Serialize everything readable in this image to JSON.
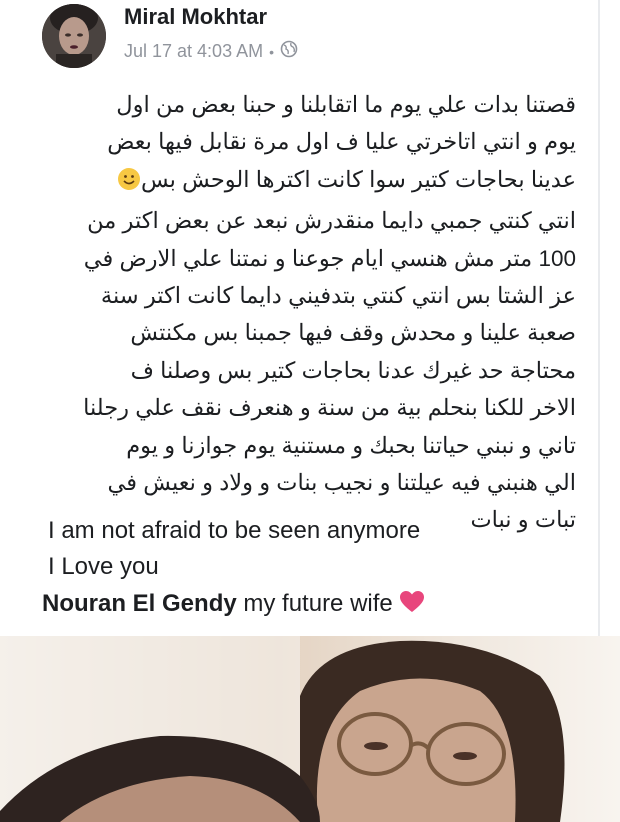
{
  "post": {
    "author": "Miral Mokhtar",
    "timestamp": "Jul 17 at 4:03 AM",
    "separator": "•",
    "privacy_icon": "globe-icon",
    "arabic_lines": [
      "قصتنا بدات علي يوم ما اتقابلنا و حبنا بعض من اول",
      "يوم و انتي اتاخرتي عليا ف اول مرة نقابل فيها بعض",
      "عدينا بحاجات كتير سوا كانت اكترها الوحش بس",
      "انتي كنتي جمبي دايما منقدرش نبعد عن بعض اكتر من",
      "100 متر مش هنسي ايام جوعنا و نمتنا علي الارض في",
      "عز الشتا بس انتي كنتي بتدفيني دايما كانت اكتر سنة",
      "صعبة علينا و محدش وقف فيها جمبنا بس مكنتش",
      "محتاجة حد غيرك عدنا بحاجات كتير بس وصلنا ف",
      "الاخر للكنا بنحلم بية من سنة و هنعرف نقف علي رجلنا",
      "تاني و نبني حياتنا بحبك و مستنية يوم جوازنا و يوم",
      "الي هنبني فيه عيلتنا و نجيب بنات و ولاد و نعيش في",
      "تبات و نبات"
    ],
    "smile_icon": "smile-emoji-icon",
    "english_line1": "I am not afraid to be seen  anymore",
    "english_line2": "I Love you",
    "tagged_name": "Nouran El Gendy",
    "tag_suffix": " my future wife",
    "heart_icon": "pink-heart-icon",
    "colors": {
      "name": "#1c1e21",
      "meta": "#90949c",
      "heart": "#e8467c",
      "emoji": "#f7c843"
    }
  }
}
